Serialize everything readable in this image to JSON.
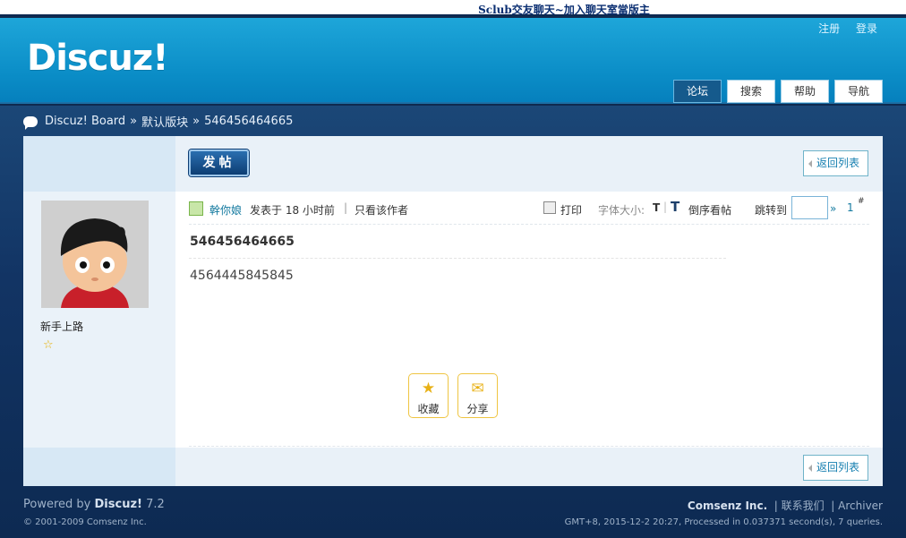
{
  "topbar": {
    "title": "Sclub交友聊天~加入聊天室當版主"
  },
  "header": {
    "logo": "Discuz!",
    "links": [
      "注册",
      "登录"
    ],
    "tabs": [
      "论坛",
      "搜索",
      "帮助",
      "导航"
    ]
  },
  "breadcrumb": {
    "board": "Discuz! Board",
    "sep1": "»",
    "forum": "默认版块",
    "sep2": "»",
    "thread": "546456464665"
  },
  "toolbar": {
    "post_label": "发帖",
    "back_label": "返回列表"
  },
  "author": {
    "name": "幹你娘",
    "rank": "新手上路",
    "stars": 1
  },
  "post_meta": {
    "posted": "发表于 18 小时前",
    "separator": "|",
    "only_author": "只看该作者",
    "print": "打印",
    "font_size": "字体大小:",
    "font_t": "T",
    "bar": "|",
    "font_t_big": "T",
    "reverse": "倒序看帖",
    "jump": "跳转到",
    "raquo": "»",
    "floor": "1",
    "floor_mark": "#"
  },
  "post": {
    "title": "546456464665",
    "body": "4564445845845"
  },
  "actions": [
    {
      "label": "收藏",
      "icon": "star-icon"
    },
    {
      "label": "分享",
      "icon": "share-icon"
    }
  ],
  "footer": {
    "powered_prefix": "Powered by",
    "powered_brand": "Discuz!",
    "powered_version": "7.2",
    "copyright": "© 2001-2009 Comsenz Inc.",
    "company": "Comsenz Inc.",
    "contact": "联系我们",
    "archiver": "Archiver",
    "stats": "GMT+8, 2015-12-2 20:27, Processed in 0.037371 second(s), 7 queries."
  },
  "colors": {
    "accent": "#0a8cc6",
    "dark": "#0f2a4f",
    "link": "#13799f"
  }
}
